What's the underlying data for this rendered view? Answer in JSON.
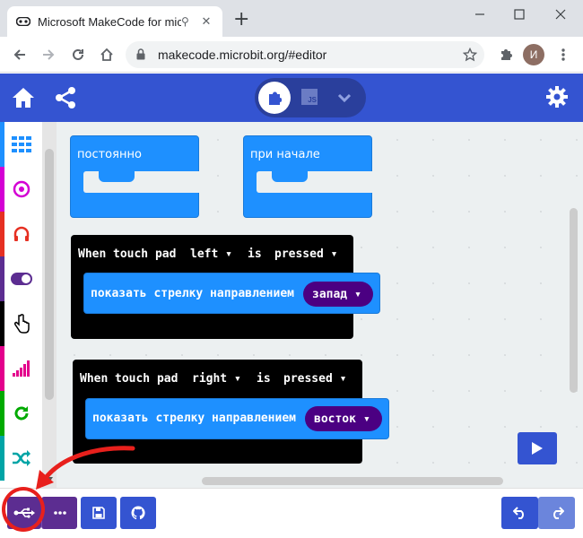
{
  "browser": {
    "tab_title": "Microsoft MakeCode for micro:bit",
    "url": "makecode.microbit.org/#editor",
    "avatar_letter": "И"
  },
  "editor": {
    "mode_js_label": "JS"
  },
  "toolbox": {
    "items": [
      {
        "name": "basic",
        "color": "#1e90ff",
        "icon": "grid-icon"
      },
      {
        "name": "input",
        "color": "#d400d4",
        "icon": "target-icon"
      },
      {
        "name": "music",
        "color": "#e63022",
        "icon": "headphones-icon"
      },
      {
        "name": "led",
        "color": "#5c2d91",
        "icon": "toggle-icon"
      },
      {
        "name": "input-touch",
        "color": "#000000",
        "icon": "hand-pointer-icon"
      },
      {
        "name": "radio",
        "color": "#e3008c",
        "icon": "signal-icon"
      },
      {
        "name": "loops",
        "color": "#00aa00",
        "icon": "refresh-icon"
      },
      {
        "name": "logic",
        "color": "#00a4a6",
        "icon": "shuffle-icon"
      }
    ]
  },
  "blocks": {
    "forever": "постоянно",
    "on_start": "при начале",
    "event1": {
      "when": "When",
      "touch_pad": "touch pad",
      "pad": "left",
      "is": "is",
      "state": "pressed",
      "action": "показать стрелку направлением",
      "direction": "запад"
    },
    "event2": {
      "when": "When",
      "touch_pad": "touch pad",
      "pad": "right",
      "is": "is",
      "state": "pressed",
      "action": "показать стрелку направлением",
      "direction": "восток"
    }
  },
  "colors": {
    "header": "#3454d1",
    "blocks_blue": "#1e90ff",
    "event_black": "#000000",
    "direction_purple": "#4b0082",
    "download_purple": "#5c2d91",
    "highlight_red": "#e8201c"
  }
}
